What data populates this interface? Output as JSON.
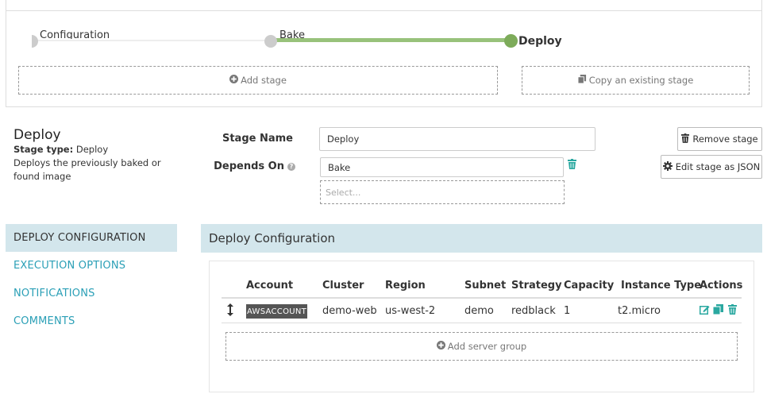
{
  "pipeline": {
    "stages": [
      {
        "label": "Configuration"
      },
      {
        "label": "Bake"
      },
      {
        "label": "Deploy"
      }
    ],
    "add_stage_label": "Add stage",
    "copy_stage_label": "Copy an existing stage"
  },
  "stage": {
    "title": "Deploy",
    "type_label": "Stage type:",
    "type_value": "Deploy",
    "description": "Deploys the previously baked or found image"
  },
  "form": {
    "stage_name_label": "Stage Name",
    "stage_name_value": "Deploy",
    "depends_on_label": "Depends On",
    "depends_on_value": "Bake",
    "select_placeholder": "Select...",
    "remove_stage_label": "Remove stage",
    "edit_json_label": "Edit stage as JSON"
  },
  "sidebar": {
    "items": [
      {
        "label": "DEPLOY CONFIGURATION"
      },
      {
        "label": "EXECUTION OPTIONS"
      },
      {
        "label": "NOTIFICATIONS"
      },
      {
        "label": "COMMENTS"
      }
    ]
  },
  "main": {
    "section_title": "Deploy Configuration",
    "table": {
      "headers": [
        "Account",
        "Cluster",
        "Region",
        "Subnet",
        "Strategy",
        "Capacity",
        "Instance Type",
        "Actions"
      ],
      "rows": [
        {
          "account": "AWSACCOUNT",
          "cluster": "demo-web",
          "region": "us-west-2",
          "subnet": "demo",
          "strategy": "redblack",
          "capacity": "1",
          "instance_type": "t2.micro"
        }
      ]
    },
    "add_server_group_label": "Add server group"
  },
  "colors": {
    "accent": "#2aa8a0",
    "link": "#2a9fb6",
    "active_stage": "#7dab5a",
    "header_bg": "#d3e6ec"
  },
  "icons": [
    "plus-circle-icon",
    "copy-icon",
    "trash-icon",
    "gear-icon",
    "help-icon",
    "sort-arrows-icon",
    "edit-icon",
    "duplicate-icon"
  ]
}
